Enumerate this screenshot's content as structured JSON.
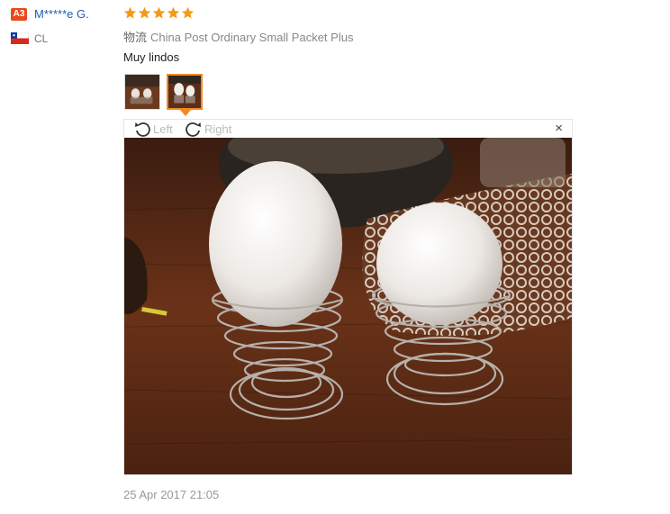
{
  "buyer": {
    "badge": "A3",
    "name": "M*****e G.",
    "country": "CL",
    "flag_icon": "chile-flag-icon"
  },
  "review": {
    "rating": 5,
    "max_rating": 5,
    "star_color": "#f39a16",
    "logistics_label": "物流",
    "logistics_value": "China Post Ordinary Small Packet Plus",
    "text": "Muy lindos",
    "date": "25 Apr 2017 21:05"
  },
  "viewer": {
    "rotate_left": "Left",
    "rotate_right": "Right",
    "close": "×",
    "selected_thumb": 2
  },
  "colors": {
    "name_link": "#1a5fb4",
    "badge_bg": "#e8491d",
    "thumb_selected": "#f08a24"
  }
}
